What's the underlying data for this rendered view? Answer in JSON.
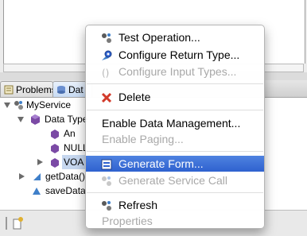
{
  "tabs": [
    {
      "label": "Problems"
    },
    {
      "label": "Dat"
    }
  ],
  "tree": {
    "root": "MyService",
    "data_types": "Data Type",
    "children": [
      "An",
      "NULL",
      "VOA"
    ],
    "get_data": "getData()",
    "save_data": "saveData"
  },
  "menu": {
    "test_operation": "Test Operation...",
    "configure_return_type": "Configure Return Type...",
    "configure_input_types": "Configure Input Types...",
    "delete": "Delete",
    "enable_data_management": "Enable Data Management...",
    "enable_paging": "Enable Paging...",
    "generate_form": "Generate Form...",
    "generate_service_call": "Generate Service Call",
    "refresh": "Refresh",
    "properties": "Properties"
  },
  "colors": {
    "highlight": "#2f62cf",
    "disabled_text": "#a8a8a8",
    "delete_icon": "#d23a2a"
  }
}
